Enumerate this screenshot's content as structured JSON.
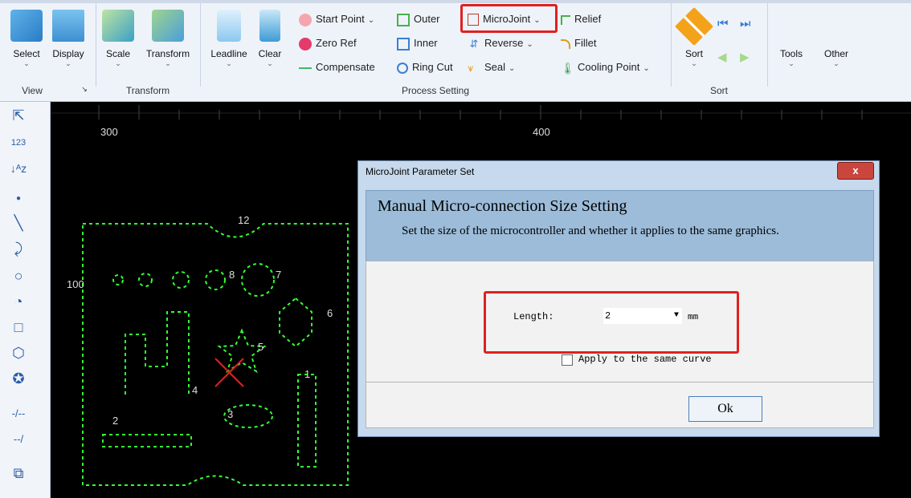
{
  "ribbon": {
    "groups": {
      "view": "View",
      "transform": "Transform",
      "process": "Process Setting",
      "sort": "Sort"
    },
    "select": "Select",
    "display": "Display",
    "scale": "Scale",
    "transform": "Transform",
    "leadline": "Leadline",
    "clear": "Clear",
    "start_point": "Start Point",
    "zero_ref": "Zero Ref",
    "compensate": "Compensate",
    "outer": "Outer",
    "inner": "Inner",
    "ring_cut": "Ring Cut",
    "microjoint": "MicroJoint",
    "reverse": "Reverse",
    "seal": "Seal",
    "relief": "Relief",
    "fillet": "Fillet",
    "cooling_point": "Cooling Point",
    "sort": "Sort",
    "tools": "Tools",
    "other": "Other",
    "accent": "#e02020"
  },
  "canvas": {
    "ruler_300": "300",
    "ruler_400": "400",
    "ruler_100": "100",
    "part_numbers": [
      "12",
      "8",
      "7",
      "6",
      "5",
      "1",
      "4",
      "2",
      "3"
    ],
    "path_color": "#33ff33"
  },
  "dialog": {
    "title": "MicroJoint Parameter Set",
    "close": "x",
    "heading": "Manual Micro-connection Size Setting",
    "description": "Set the size of the microcontroller and whether it applies to the same graphics.",
    "length_label": "Length:",
    "length_value": "2",
    "unit": "mm",
    "apply_label": "Apply to the same curve",
    "ok": "Ok"
  }
}
